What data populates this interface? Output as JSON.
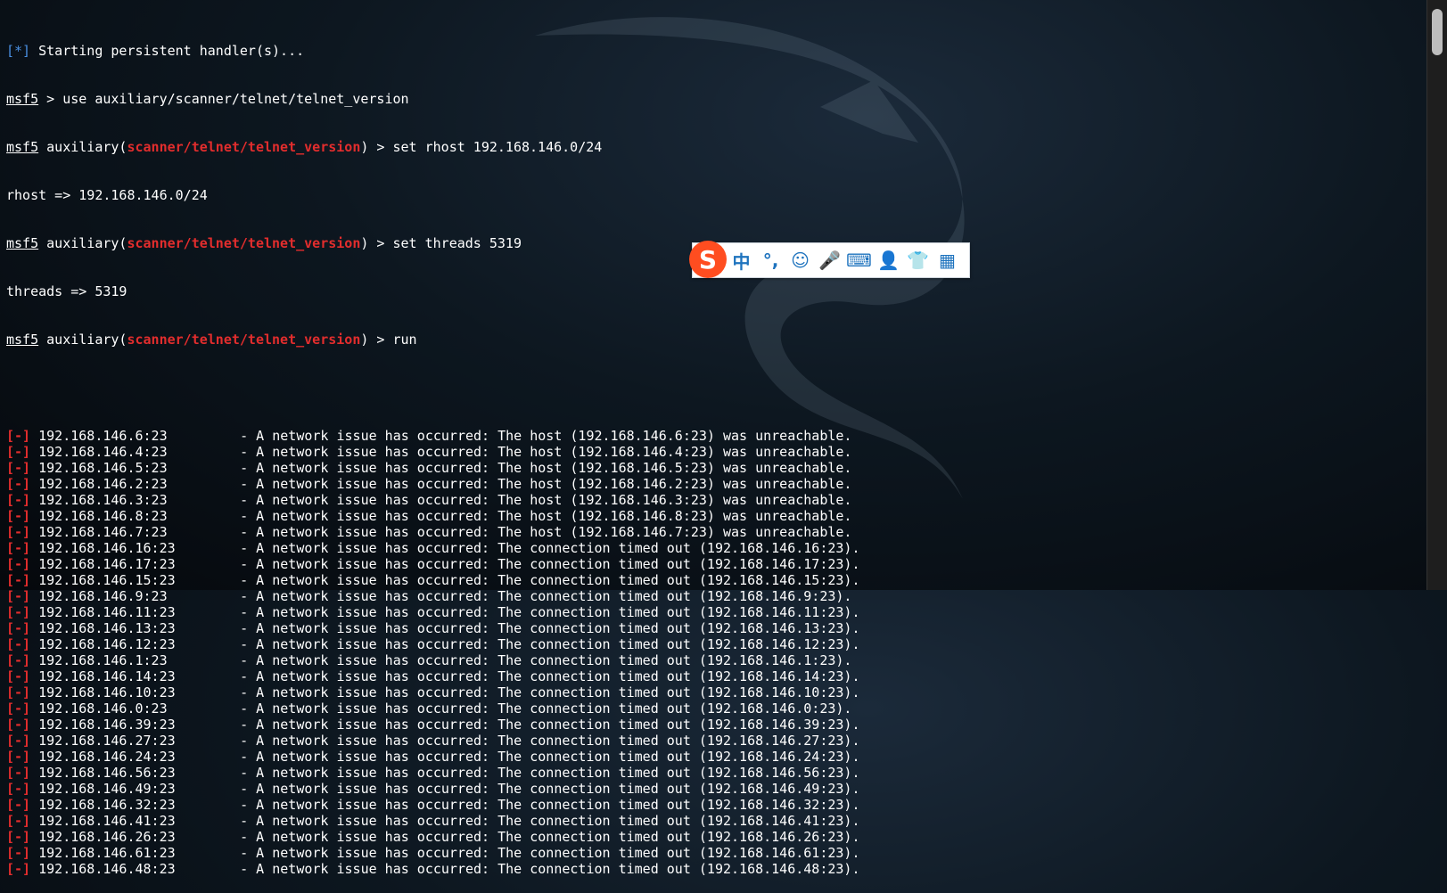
{
  "colors": {
    "prompt_blue": "#4a90e2",
    "module_red": "#e22d2d",
    "text": "#ffffff",
    "ime_accent": "#1e73be",
    "ime_logo": "#ff4d20"
  },
  "terminal": {
    "header": {
      "star_marker": "[*]",
      "starting_text": " Starting persistent handler(s)...",
      "prompt": "msf5",
      "cmd_use": " > use auxiliary/scanner/telnet/telnet_version",
      "aux_open": " auxiliary(",
      "module": "scanner/telnet/telnet_version",
      "aux_close_rhost": ") > set rhost 192.168.146.0/24",
      "rhost_result": "rhost => 192.168.146.0/24",
      "aux_close_threads": ") > set threads 5319",
      "threads_result": "threads => 5319",
      "aux_close_run": ") > run"
    },
    "error_marker": "[-]",
    "results": [
      {
        "ip": "192.168.146.6:23",
        "msg": "- A network issue has occurred: The host (192.168.146.6:23) was unreachable."
      },
      {
        "ip": "192.168.146.4:23",
        "msg": "- A network issue has occurred: The host (192.168.146.4:23) was unreachable."
      },
      {
        "ip": "192.168.146.5:23",
        "msg": "- A network issue has occurred: The host (192.168.146.5:23) was unreachable."
      },
      {
        "ip": "192.168.146.2:23",
        "msg": "- A network issue has occurred: The host (192.168.146.2:23) was unreachable."
      },
      {
        "ip": "192.168.146.3:23",
        "msg": "- A network issue has occurred: The host (192.168.146.3:23) was unreachable."
      },
      {
        "ip": "192.168.146.8:23",
        "msg": "- A network issue has occurred: The host (192.168.146.8:23) was unreachable."
      },
      {
        "ip": "192.168.146.7:23",
        "msg": "- A network issue has occurred: The host (192.168.146.7:23) was unreachable."
      },
      {
        "ip": "192.168.146.16:23",
        "msg": "- A network issue has occurred: The connection timed out (192.168.146.16:23)."
      },
      {
        "ip": "192.168.146.17:23",
        "msg": "- A network issue has occurred: The connection timed out (192.168.146.17:23)."
      },
      {
        "ip": "192.168.146.15:23",
        "msg": "- A network issue has occurred: The connection timed out (192.168.146.15:23)."
      },
      {
        "ip": "192.168.146.9:23",
        "msg": "- A network issue has occurred: The connection timed out (192.168.146.9:23)."
      },
      {
        "ip": "192.168.146.11:23",
        "msg": "- A network issue has occurred: The connection timed out (192.168.146.11:23)."
      },
      {
        "ip": "192.168.146.13:23",
        "msg": "- A network issue has occurred: The connection timed out (192.168.146.13:23)."
      },
      {
        "ip": "192.168.146.12:23",
        "msg": "- A network issue has occurred: The connection timed out (192.168.146.12:23)."
      },
      {
        "ip": "192.168.146.1:23",
        "msg": "- A network issue has occurred: The connection timed out (192.168.146.1:23)."
      },
      {
        "ip": "192.168.146.14:23",
        "msg": "- A network issue has occurred: The connection timed out (192.168.146.14:23)."
      },
      {
        "ip": "192.168.146.10:23",
        "msg": "- A network issue has occurred: The connection timed out (192.168.146.10:23)."
      },
      {
        "ip": "192.168.146.0:23",
        "msg": "- A network issue has occurred: The connection timed out (192.168.146.0:23)."
      },
      {
        "ip": "192.168.146.39:23",
        "msg": "- A network issue has occurred: The connection timed out (192.168.146.39:23)."
      },
      {
        "ip": "192.168.146.27:23",
        "msg": "- A network issue has occurred: The connection timed out (192.168.146.27:23)."
      },
      {
        "ip": "192.168.146.24:23",
        "msg": "- A network issue has occurred: The connection timed out (192.168.146.24:23)."
      },
      {
        "ip": "192.168.146.56:23",
        "msg": "- A network issue has occurred: The connection timed out (192.168.146.56:23)."
      },
      {
        "ip": "192.168.146.49:23",
        "msg": "- A network issue has occurred: The connection timed out (192.168.146.49:23)."
      },
      {
        "ip": "192.168.146.32:23",
        "msg": "- A network issue has occurred: The connection timed out (192.168.146.32:23)."
      },
      {
        "ip": "192.168.146.41:23",
        "msg": "- A network issue has occurred: The connection timed out (192.168.146.41:23)."
      },
      {
        "ip": "192.168.146.26:23",
        "msg": "- A network issue has occurred: The connection timed out (192.168.146.26:23)."
      },
      {
        "ip": "192.168.146.61:23",
        "msg": "- A network issue has occurred: The connection timed out (192.168.146.61:23)."
      },
      {
        "ip": "192.168.146.48:23",
        "msg": "- A network issue has occurred: The connection timed out (192.168.146.48:23)."
      }
    ]
  },
  "ime_toolbar": {
    "logo_text": "S",
    "buttons": [
      {
        "name": "chinese-mode-button",
        "glyph": "中"
      },
      {
        "name": "punctuation-button",
        "glyph": "°,"
      },
      {
        "name": "emoji-button",
        "glyph": "☺"
      },
      {
        "name": "voice-input-button",
        "glyph": "🎤"
      },
      {
        "name": "keyboard-button",
        "glyph": "⌨"
      },
      {
        "name": "account-button",
        "glyph": "👤"
      },
      {
        "name": "skin-button",
        "glyph": "👕"
      },
      {
        "name": "toolbox-button",
        "glyph": "▦"
      }
    ]
  }
}
